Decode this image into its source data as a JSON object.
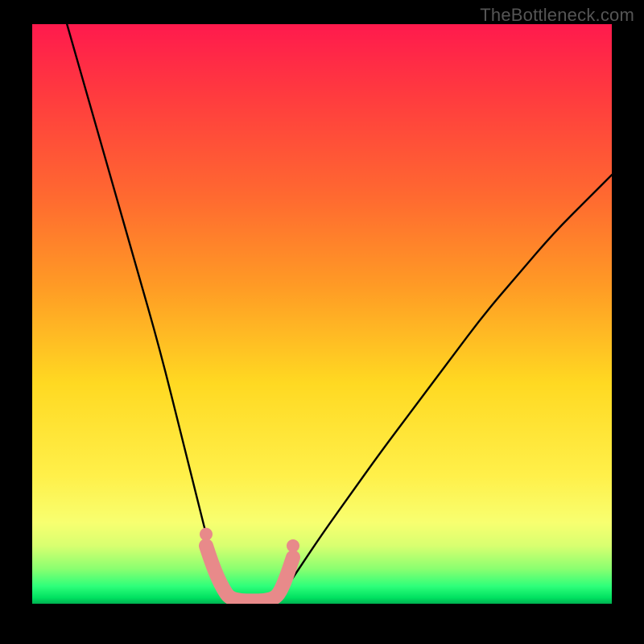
{
  "watermark": "TheBottleneck.com",
  "chart_data": {
    "type": "line",
    "title": "",
    "xlabel": "",
    "ylabel": "",
    "xlim": [
      0,
      100
    ],
    "ylim": [
      0,
      100
    ],
    "series": [
      {
        "name": "bottleneck-curve-left",
        "x": [
          6,
          10,
          14,
          18,
          22,
          26,
          27,
          28,
          29,
          30,
          31,
          32,
          33,
          34,
          35
        ],
        "y": [
          100,
          86,
          72,
          58,
          44,
          28,
          24,
          20,
          16,
          12,
          9,
          6,
          3.5,
          1.5,
          0
        ]
      },
      {
        "name": "bottleneck-curve-right",
        "x": [
          42,
          44,
          46,
          50,
          55,
          60,
          66,
          72,
          78,
          84,
          90,
          96,
          100
        ],
        "y": [
          0,
          3,
          6,
          12,
          19,
          26,
          34,
          42,
          50,
          57,
          64,
          70,
          74
        ]
      },
      {
        "name": "u-marker",
        "x": [
          30,
          31,
          32,
          33,
          34,
          36,
          38,
          40,
          42,
          43,
          44,
          45
        ],
        "y": [
          10,
          7,
          4.5,
          2.5,
          1,
          0.5,
          0.5,
          0.5,
          1,
          2.5,
          5,
          8
        ]
      }
    ],
    "marker_color": "#e88a8a",
    "line_color": "#000000"
  }
}
